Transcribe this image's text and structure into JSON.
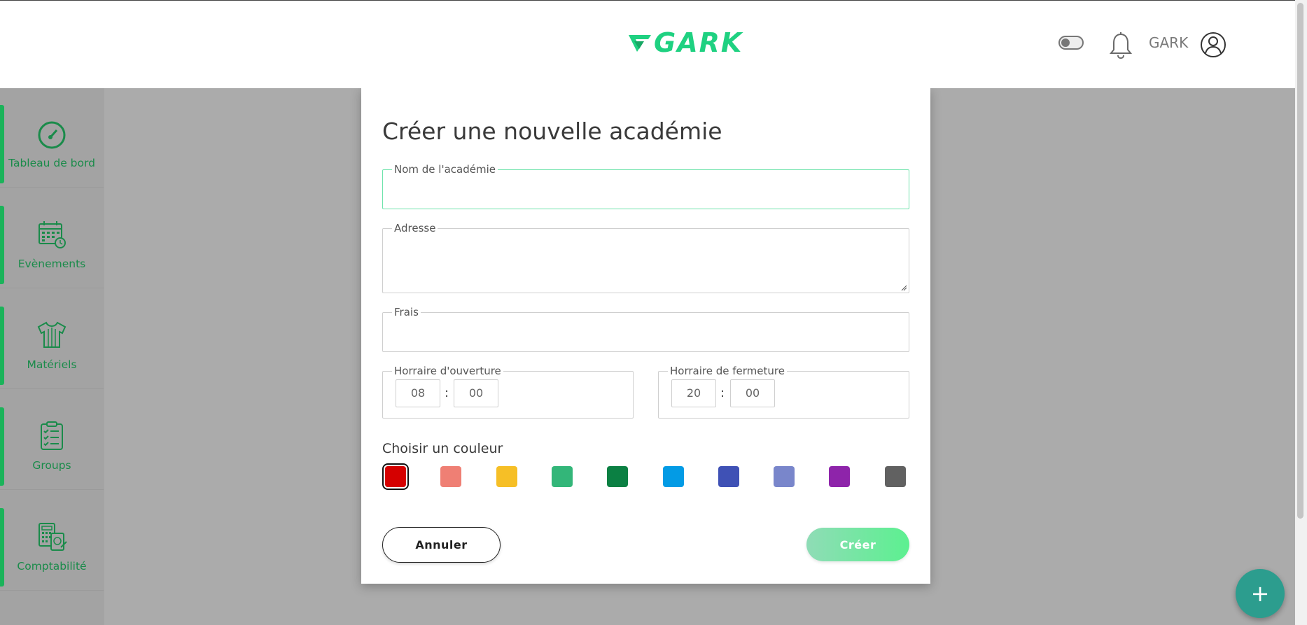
{
  "header": {
    "logo_text": "GARK",
    "username": "GARK",
    "theme_toggle_state": "off",
    "icons": [
      "theme-toggle",
      "bell-icon",
      "user-circle-icon"
    ]
  },
  "sidebar": {
    "items": [
      {
        "label": "Tableau de bord",
        "icon": "speedometer-icon"
      },
      {
        "label": "Evènements",
        "icon": "calendar-icon"
      },
      {
        "label": "Matériels",
        "icon": "jersey-icon"
      },
      {
        "label": "Groups",
        "icon": "clipboard-list-icon"
      },
      {
        "label": "Comptabilité",
        "icon": "accounting-icon"
      }
    ]
  },
  "modal": {
    "title": "Créer une nouvelle académie",
    "fields": {
      "name": {
        "label": "Nom de l'académie",
        "value": ""
      },
      "address": {
        "label": "Adresse",
        "value": ""
      },
      "fees": {
        "label": "Frais",
        "value": ""
      }
    },
    "opening": {
      "label": "Horraire d'ouverture",
      "hour": "08",
      "minute": "00",
      "separator": ":"
    },
    "closing": {
      "label": "Horraire de fermeture",
      "hour": "20",
      "minute": "00",
      "separator": ":"
    },
    "color_label": "Choisir un couleur",
    "colors": [
      "#d50000",
      "#ef7f74",
      "#f6bf26",
      "#33b679",
      "#0b8043",
      "#039be5",
      "#3f51b5",
      "#7986cb",
      "#8e24aa",
      "#616161"
    ],
    "selected_color": "#d50000",
    "cancel_label": "Annuler",
    "create_label": "Créer"
  },
  "fab": {
    "label": "+"
  },
  "colors": {
    "brand_green": "#1fd181",
    "sidebar_accent": "#1bb35a",
    "fab": "#2c9d8e"
  }
}
